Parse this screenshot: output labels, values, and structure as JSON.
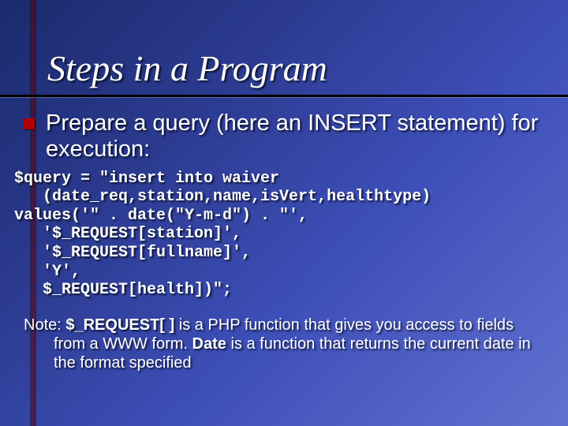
{
  "title": "Steps in a Program",
  "bullet": {
    "text": "Prepare a query (here an INSERT statement) for execution:"
  },
  "code": {
    "l1": "$query = \"insert into waiver",
    "l2": "   (date_req,station,name,isVert,healthtype)",
    "l3": "values('\" . date(\"Y-m-d\") . \"',",
    "l4": "   '$_REQUEST[station]',",
    "l5": "   '$_REQUEST[fullname]',",
    "l6": "   'Y',",
    "l7": "   $_REQUEST[health])\";"
  },
  "note": {
    "prefix": "Note: ",
    "req": "$_REQUEST[ ]",
    "mid1": " is a PHP function that gives you access to fields from a WWW form. ",
    "date": "Date",
    "mid2": " is a function that returns the current date in the format specified"
  }
}
